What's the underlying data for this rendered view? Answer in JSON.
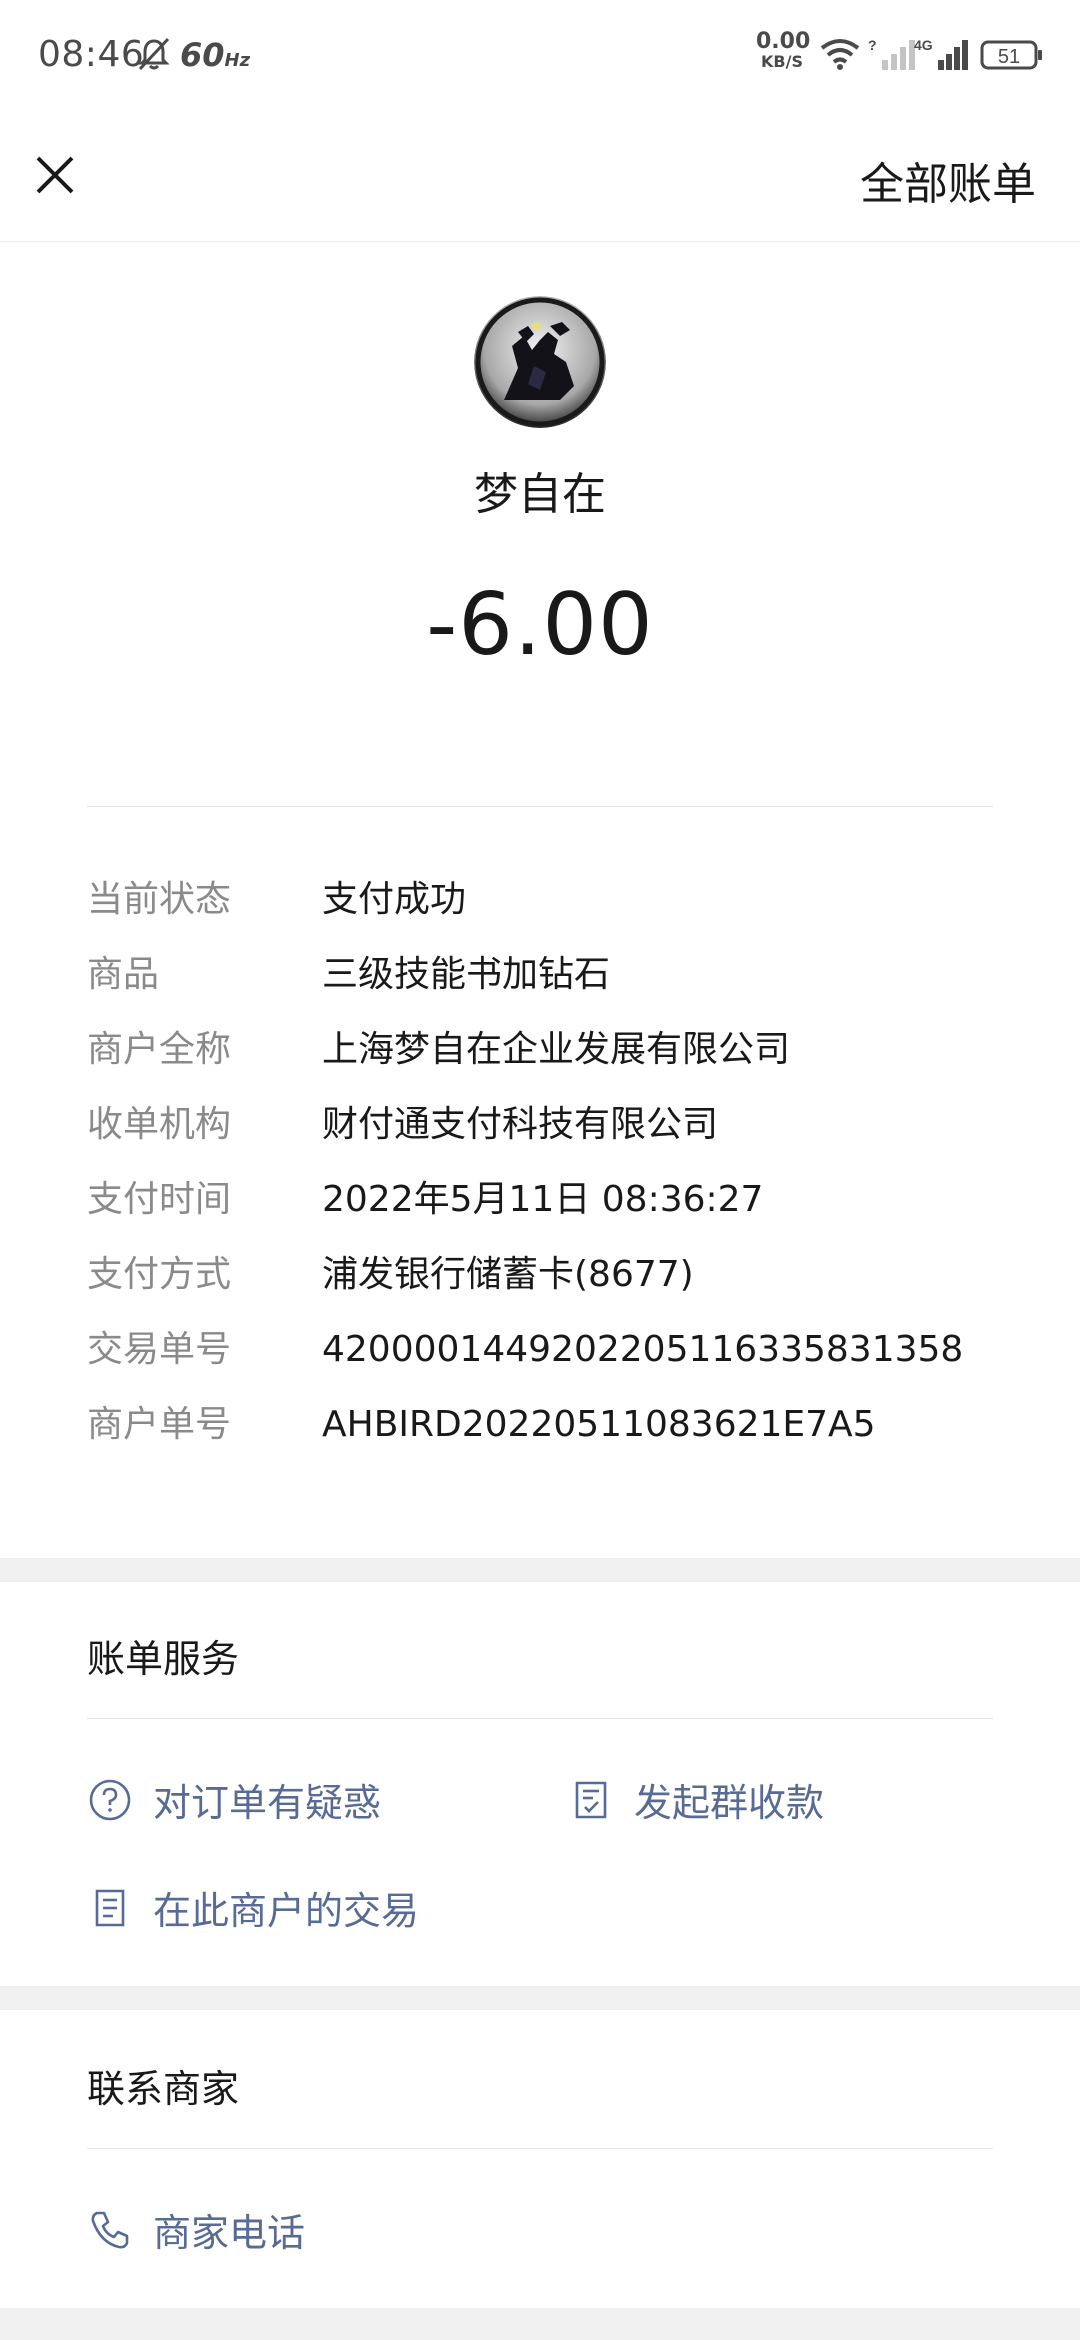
{
  "status_bar": {
    "time": "08:46",
    "refresh": "60",
    "refresh_unit": "Hz",
    "net_speed": "0.00",
    "net_unit": "KB/S",
    "battery": "51"
  },
  "nav": {
    "all_bills": "全部账单"
  },
  "header": {
    "merchant": "梦自在",
    "amount": "-6.00"
  },
  "details": [
    {
      "label": "当前状态",
      "value": "支付成功"
    },
    {
      "label": "商品",
      "value": "三级技能书加钻石"
    },
    {
      "label": "商户全称",
      "value": "上海梦自在企业发展有限公司"
    },
    {
      "label": "收单机构",
      "value": "财付通支付科技有限公司"
    },
    {
      "label": "支付时间",
      "value": "2022年5月11日 08:36:27"
    },
    {
      "label": "支付方式",
      "value": "浦发银行储蓄卡(8677)"
    },
    {
      "label": "交易单号",
      "value": "4200001449202205116335831358"
    },
    {
      "label": "商户单号",
      "value": "AHBIRD20220511083621E7A5"
    }
  ],
  "bill_service": {
    "title": "账单服务",
    "question": "对订单有疑惑",
    "group_collect": "发起群收款",
    "merchant_tx": "在此商户的交易"
  },
  "contact": {
    "title": "联系商家",
    "phone": "商家电话"
  },
  "colors": {
    "link": "#576b95",
    "label": "#8a8a8a",
    "text": "#191919",
    "separator": "#f0f0f0"
  }
}
